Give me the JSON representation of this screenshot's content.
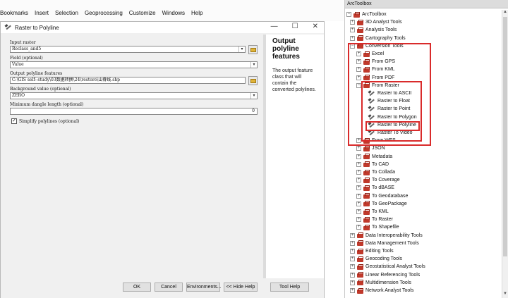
{
  "menubar": [
    "Bookmarks",
    "Insert",
    "Selection",
    "Geoprocessing",
    "Customize",
    "Windows",
    "Help"
  ],
  "dialog": {
    "title": "Raster to Polyline",
    "winbtns": [
      "—",
      "☐",
      "✕"
    ],
    "params": {
      "input_raster_label": "Input raster",
      "input_raster_value": "Reclass_and5",
      "field_label": "Field (optional)",
      "field_value": "Value",
      "output_label": "Output polyline features",
      "output_value": "C:\\GIS  self--study\\03数据转换\\24\\restore\\山脊线.shp",
      "background_label": "Background value (optional)",
      "background_value": "ZERO",
      "dangle_label": "Minimum dangle length (optional)",
      "dangle_value": "0",
      "simplify_label": "Simplify polylines (optional)",
      "simplify_checked": "✓"
    },
    "help": {
      "title": "Output polyline features",
      "text": "The output feature class that will contain the converted polylines."
    },
    "buttons": {
      "ok": "OK",
      "cancel": "Cancel",
      "environments": "Environments...",
      "hide_help": "<< Hide Help",
      "tool_help": "Tool Help"
    }
  },
  "toolbox": {
    "title": "ArcToolbox",
    "root": "ArcToolbox",
    "top_items": [
      "3D Analyst Tools",
      "Analysis Tools",
      "Cartography Tools",
      "Conversion Tools"
    ],
    "conversion_children": [
      "Excel",
      "From GPS",
      "From KML",
      "From PDF",
      "From Raster"
    ],
    "from_raster_tools": [
      "Raster to ASCII",
      "Raster to Float",
      "Raster to Point",
      "Raster to Polygon",
      "Raster to Polyline",
      "Raster To Video"
    ],
    "conversion_rest": [
      "From WFS",
      "JSON",
      "Metadata",
      "To CAD",
      "To Collada",
      "To Coverage",
      "To dBASE",
      "To Geodatabase",
      "To GeoPackage",
      "To KML",
      "To Raster",
      "To Shapefile"
    ],
    "bottom_items": [
      "Data Interoperability Tools",
      "Data Management Tools",
      "Editing Tools",
      "Geocoding Tools",
      "Geostatistical Analyst Tools",
      "Linear Referencing Tools",
      "Multidimension Tools",
      "Network Analyst Tools"
    ],
    "expand_plus": "+",
    "expand_minus": "−"
  },
  "colors": {
    "highlight": "#d92b2b",
    "toolbox_red": "#c0392b",
    "folder": "#e0b43a"
  }
}
